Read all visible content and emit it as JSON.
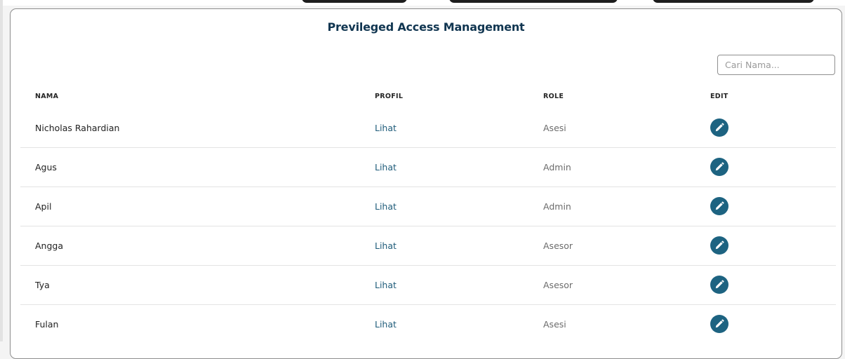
{
  "page": {
    "title": "Previleged Access Management"
  },
  "search": {
    "placeholder": "Cari Nama..."
  },
  "table": {
    "columns": [
      "NAMA",
      "PROFIL",
      "ROLE",
      "EDIT"
    ],
    "rows": [
      {
        "name": "Nicholas Rahardian",
        "profile": "Lihat",
        "role": "Asesi"
      },
      {
        "name": "Agus",
        "profile": "Lihat",
        "role": "Admin"
      },
      {
        "name": "Apil",
        "profile": "Lihat",
        "role": "Admin"
      },
      {
        "name": "Angga",
        "profile": "Lihat",
        "role": "Asesor"
      },
      {
        "name": "Tya",
        "profile": "Lihat",
        "role": "Asesor"
      },
      {
        "name": "Fulan",
        "profile": "Lihat",
        "role": "Asesi"
      }
    ]
  },
  "icons": {
    "edit": "pencil-icon"
  },
  "colors": {
    "title": "#113651",
    "link": "#1f5c7a",
    "edit_button": "#1d6381"
  }
}
